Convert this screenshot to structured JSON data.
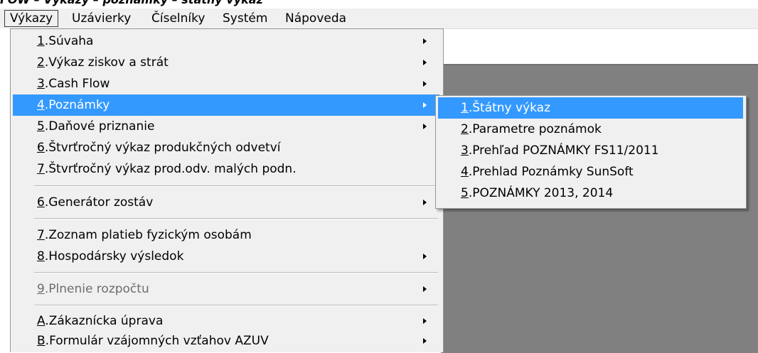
{
  "caption": "FOW – Výkazy – poznámky – štátny výkaz",
  "menubar": [
    "Výkazy",
    "Uzávierky",
    "Číselníky",
    "Systém",
    "Nápoveda"
  ],
  "main_menu": [
    {
      "mnemonic": "1",
      "rest": ".Súvaha",
      "arrow": true
    },
    {
      "mnemonic": "2",
      "rest": ".Výkaz ziskov a strát",
      "arrow": true
    },
    {
      "mnemonic": "3",
      "rest": ".Cash Flow",
      "arrow": true
    },
    {
      "mnemonic": "4",
      "rest": ".Poznámky",
      "arrow": true,
      "selected": true
    },
    {
      "mnemonic": "5",
      "rest": ".Daňové priznanie",
      "arrow": true
    },
    {
      "mnemonic": "6",
      "rest": ".Štvrťročný výkaz produkčných odvetví",
      "arrow": false
    },
    {
      "mnemonic": "7",
      "rest": ".Štvrťročný výkaz prod.odv. malých podn.",
      "arrow": false
    },
    {
      "mnemonic": "6",
      "rest": ".Generátor zostáv",
      "arrow": true
    },
    {
      "mnemonic": "7",
      "rest": ".Zoznam platieb fyzickým osobám",
      "arrow": false
    },
    {
      "mnemonic": "8",
      "rest": ".Hospodársky výsledok",
      "arrow": true
    },
    {
      "mnemonic": "9",
      "rest": ".Plnenie rozpočtu",
      "arrow": true,
      "disabled": true
    },
    {
      "mnemonic": "A",
      "rest": ".Zákaznícka úprava",
      "arrow": true
    },
    {
      "mnemonic": "B",
      "rest": ".Formulár vzájomných vzťahov AZUV",
      "arrow": true
    }
  ],
  "sub_menu": [
    {
      "mnemonic": "1",
      "rest": ".Štátny výkaz",
      "selected": true
    },
    {
      "mnemonic": "2",
      "rest": ".Parametre poznámok"
    },
    {
      "mnemonic": "3",
      "rest": ".Prehľad POZNÁMKY FS11/2011"
    },
    {
      "mnemonic": "4",
      "rest": ".Prehlad Poznámky SunSoft"
    },
    {
      "mnemonic": "5",
      "rest": ".POZNÁMKY 2013, 2014"
    }
  ]
}
